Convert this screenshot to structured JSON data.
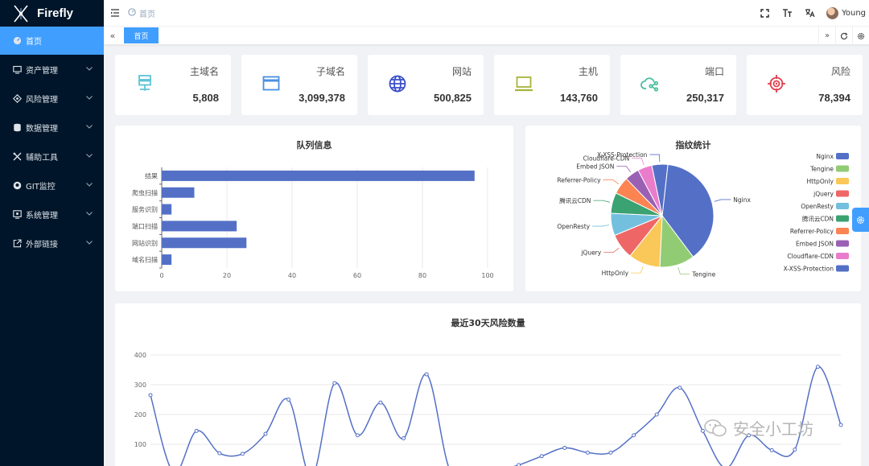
{
  "app": {
    "title": "Firefly"
  },
  "sidebar": {
    "items": [
      {
        "label": "首页",
        "icon": "dashboard-icon",
        "active": true,
        "expandable": false
      },
      {
        "label": "资产管理",
        "icon": "asset-icon",
        "active": false,
        "expandable": true
      },
      {
        "label": "风险管理",
        "icon": "risk-icon",
        "active": false,
        "expandable": true
      },
      {
        "label": "数据管理",
        "icon": "database-icon",
        "active": false,
        "expandable": true
      },
      {
        "label": "辅助工具",
        "icon": "tools-icon",
        "active": false,
        "expandable": true
      },
      {
        "label": "GIT监控",
        "icon": "github-icon",
        "active": false,
        "expandable": true
      },
      {
        "label": "系统管理",
        "icon": "system-icon",
        "active": false,
        "expandable": true
      },
      {
        "label": "外部链接",
        "icon": "external-link-icon",
        "active": false,
        "expandable": true
      }
    ]
  },
  "navbar": {
    "breadcrumb": "首页",
    "user_name": "Young"
  },
  "tags": {
    "active": "首页"
  },
  "stats": [
    {
      "label": "主域名",
      "value": "5,808",
      "icon": "server-icon",
      "color": "#5cc4d6"
    },
    {
      "label": "子域名",
      "value": "3,099,378",
      "icon": "window-icon",
      "color": "#4a90e2"
    },
    {
      "label": "网站",
      "value": "500,825",
      "icon": "globe-icon",
      "color": "#3b4fc9"
    },
    {
      "label": "主机",
      "value": "143,760",
      "icon": "laptop-icon",
      "color": "#a8b33a"
    },
    {
      "label": "端口",
      "value": "250,317",
      "icon": "cloud-share-icon",
      "color": "#4cc0a0"
    },
    {
      "label": "风险",
      "value": "78,394",
      "icon": "target-icon",
      "color": "#e0404e"
    }
  ],
  "chart_data": [
    {
      "type": "bar",
      "orientation": "horizontal",
      "title": "队列信息",
      "categories": [
        "域名扫描",
        "网站识别",
        "端口扫描",
        "服务识别",
        "爬虫扫描",
        "结果"
      ],
      "values": [
        3,
        26,
        23,
        3,
        10,
        96
      ],
      "xlim": [
        0,
        100
      ],
      "xticks": [
        0,
        20,
        40,
        60,
        80,
        100
      ],
      "color": "#5470c6",
      "grid": true
    },
    {
      "type": "pie",
      "title": "指纹统计",
      "legend_position": "right",
      "slices": [
        {
          "name": "Nginx",
          "value": 38,
          "color": "#5470c6"
        },
        {
          "name": "Tengine",
          "value": 11,
          "color": "#91cc75"
        },
        {
          "name": "HttpOnly",
          "value": 10,
          "color": "#fac858"
        },
        {
          "name": "jQuery",
          "value": 8,
          "color": "#ee6666"
        },
        {
          "name": "OpenResty",
          "value": 7,
          "color": "#73c0de"
        },
        {
          "name": "腾讯云CDN",
          "value": 6.5,
          "color": "#3ba272"
        },
        {
          "name": "Referrer-Policy",
          "value": 5.5,
          "color": "#fc8452"
        },
        {
          "name": "Embed JSON",
          "value": 4.5,
          "color": "#9a60b4"
        },
        {
          "name": "Cloudflare-CDN",
          "value": 4.5,
          "color": "#ea7ccc"
        },
        {
          "name": "X-XSS-Protection",
          "value": 5,
          "color": "#5470c6"
        }
      ]
    },
    {
      "type": "line",
      "title": "最近30天风险数量",
      "smooth": true,
      "ylim": [
        0,
        400
      ],
      "yticks": [
        100,
        200,
        300,
        400
      ],
      "color": "#5470c6",
      "grid": true,
      "values": [
        265,
        5,
        145,
        70,
        68,
        135,
        250,
        -10,
        305,
        130,
        240,
        120,
        335,
        15,
        -10,
        10,
        30,
        60,
        88,
        72,
        72,
        130,
        200,
        290,
        145,
        20,
        130,
        80,
        82,
        360,
        165
      ]
    }
  ],
  "watermark": {
    "text": "安全小工坊"
  }
}
